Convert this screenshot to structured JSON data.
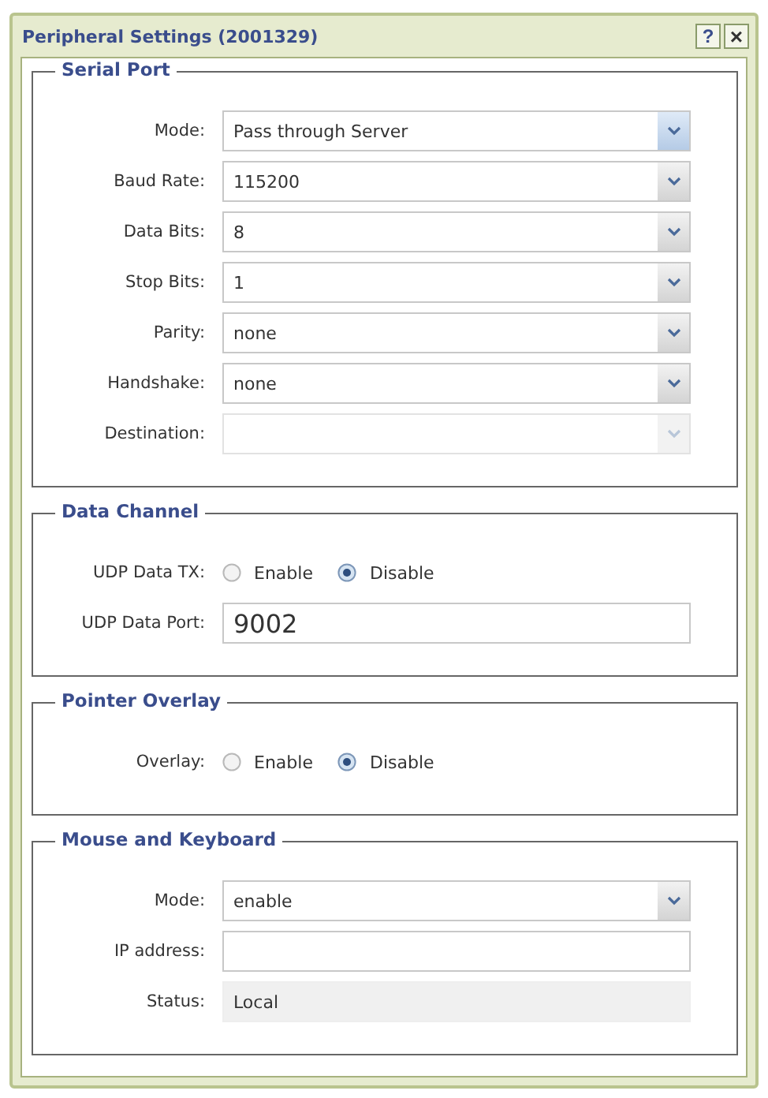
{
  "window": {
    "title": "Peripheral Settings (2001329)"
  },
  "title_buttons": [
    {
      "kind": "help",
      "text": "?"
    },
    {
      "kind": "close",
      "text": "×"
    }
  ],
  "sections": [
    {
      "title": "Serial Port",
      "rows": [
        {
          "kind": "select",
          "label": "Mode:",
          "value": "Pass through Server",
          "disabled": false,
          "focused": true
        },
        {
          "kind": "select",
          "label": "Baud Rate:",
          "value": "115200",
          "disabled": false,
          "focused": false
        },
        {
          "kind": "select",
          "label": "Data Bits:",
          "value": "8",
          "disabled": false,
          "focused": false
        },
        {
          "kind": "select",
          "label": "Stop Bits:",
          "value": "1",
          "disabled": false,
          "focused": false
        },
        {
          "kind": "select",
          "label": "Parity:",
          "value": "none",
          "disabled": false,
          "focused": false
        },
        {
          "kind": "select",
          "label": "Handshake:",
          "value": "none",
          "disabled": false,
          "focused": false
        },
        {
          "kind": "select",
          "label": "Destination:",
          "disabled": true,
          "focused": false
        }
      ]
    },
    {
      "title": "Data Channel",
      "rows": [
        {
          "kind": "radio",
          "label": "UDP Data TX:",
          "options": [
            {
              "label": "Enable",
              "selected": false
            },
            {
              "label": "Disable",
              "selected": true
            }
          ]
        },
        {
          "kind": "text",
          "label": "UDP Data Port:",
          "value": "9002"
        }
      ]
    },
    {
      "title": "Pointer Overlay",
      "rows": [
        {
          "kind": "radio",
          "label": "Overlay:",
          "options": [
            {
              "label": "Enable",
              "selected": false
            },
            {
              "label": "Disable",
              "selected": true
            }
          ]
        }
      ]
    },
    {
      "title": "Mouse and Keyboard",
      "rows": [
        {
          "kind": "select",
          "label": "Mode:",
          "value": "enable",
          "disabled": false,
          "focused": false
        },
        {
          "kind": "text",
          "label": "IP address:"
        },
        {
          "kind": "readonly",
          "label": "Status:",
          "value": "Local"
        }
      ]
    }
  ]
}
